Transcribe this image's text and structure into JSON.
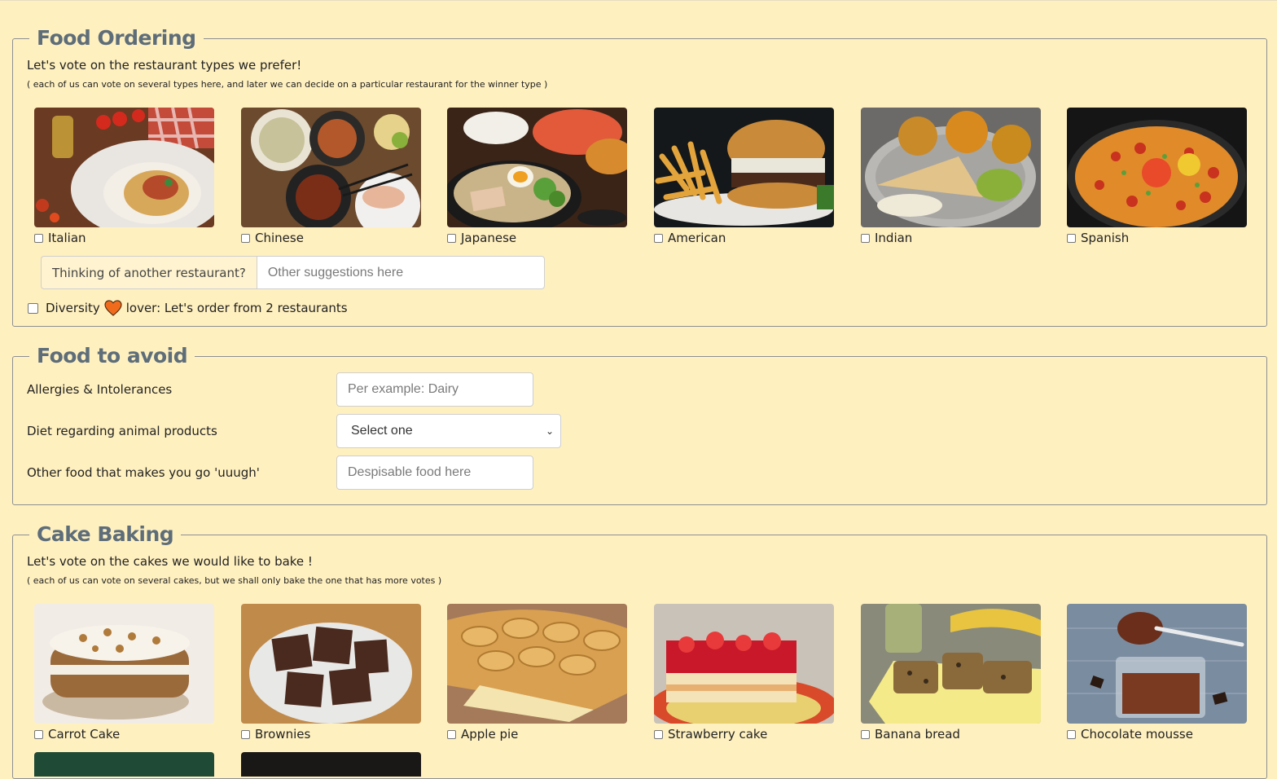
{
  "ordering": {
    "title": "Food Ordering",
    "lead": "Let's vote on the restaurant types we prefer!",
    "sub": "( each of us can vote on several types here, and later we can decide on a particular restaurant for the winner type )",
    "options": [
      {
        "label": "Italian",
        "image": "spaghetti-photo"
      },
      {
        "label": "Chinese",
        "image": "chinese-dishes-photo"
      },
      {
        "label": "Japanese",
        "image": "ramen-photo"
      },
      {
        "label": "American",
        "image": "burger-fries-photo"
      },
      {
        "label": "Indian",
        "image": "thali-photo"
      },
      {
        "label": "Spanish",
        "image": "paella-photo"
      }
    ],
    "other_addon": "Thinking of another restaurant?",
    "other_placeholder": "Other suggestions here",
    "diversity_prefix": "Diversity",
    "diversity_suffix": "lover: Let's order from 2 restaurants",
    "heart_color": "#f06c1c"
  },
  "avoid": {
    "title": "Food to avoid",
    "allergies_label": "Allergies & Intolerances",
    "allergies_placeholder": "Per example: Dairy",
    "diet_label": "Diet regarding animal products",
    "diet_selected": "Select one",
    "other_label": "Other food that makes you go 'uuugh'",
    "other_placeholder": "Despisable food here"
  },
  "cake": {
    "title": "Cake Baking",
    "lead": "Let's vote on the cakes we would like to bake !",
    "sub": "( each of us can vote on several cakes, but we shall only bake the one that has more votes )",
    "options": [
      {
        "label": "Carrot Cake",
        "image": "carrot-cake-photo"
      },
      {
        "label": "Brownies",
        "image": "brownies-photo"
      },
      {
        "label": "Apple pie",
        "image": "apple-pie-photo"
      },
      {
        "label": "Strawberry cake",
        "image": "strawberry-cake-photo"
      },
      {
        "label": "Banana bread",
        "image": "banana-bread-photo"
      },
      {
        "label": "Chocolate mousse",
        "image": "chocolate-mousse-photo"
      }
    ]
  },
  "colors": {
    "background": "#fff0bf",
    "legend": "#5d6d79",
    "border": "#8c8f93"
  }
}
